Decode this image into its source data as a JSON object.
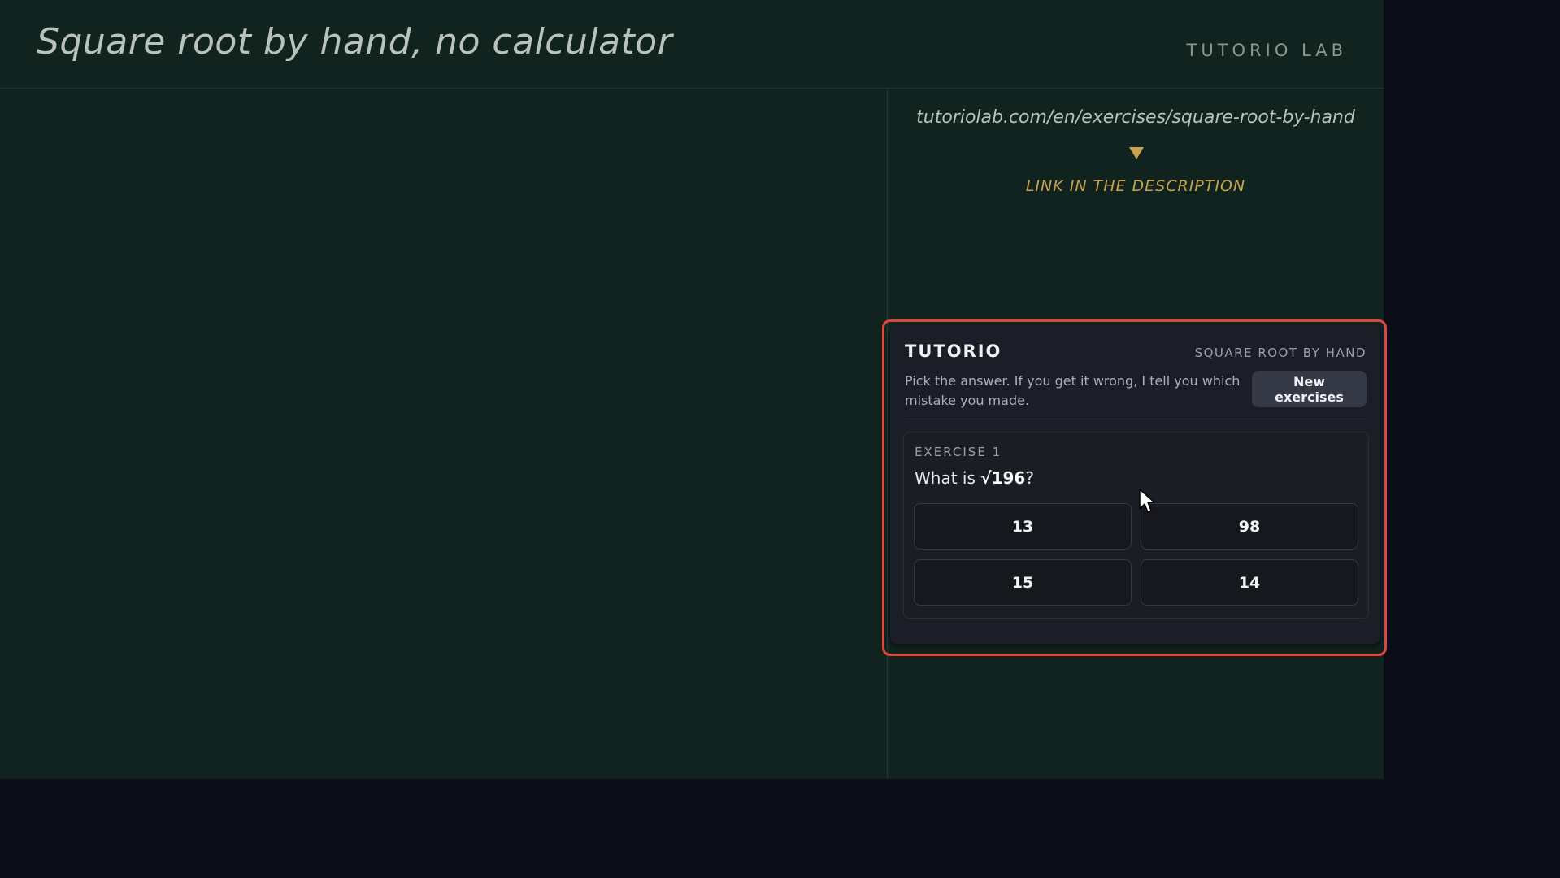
{
  "header": {
    "title": "Square root by hand, no calculator",
    "brand": "TUTORIO LAB"
  },
  "sidebar": {
    "url": "tutoriolab.com/en/exercises/square-root-by-hand",
    "link_hint": "LINK IN THE DESCRIPTION"
  },
  "widget": {
    "brand": "TUTORIO",
    "topic": "SQUARE ROOT BY HAND",
    "description": "Pick the answer. If you get it wrong, I tell you which mistake you made.",
    "new_button_label": "New exercises",
    "exercise": {
      "label": "EXERCISE 1",
      "question_prefix": "What is ",
      "question_value": "√196",
      "question_suffix": "?",
      "options": [
        "13",
        "98",
        "15",
        "14"
      ]
    }
  },
  "colors": {
    "stage_bg": "#10231e",
    "accent_gold": "#c9a24c",
    "highlight_red": "#e0463a",
    "widget_bg": "#1b1e26"
  },
  "icons": {
    "pointer": "mouse-pointer-icon",
    "arrow": "arrow-down-icon"
  }
}
